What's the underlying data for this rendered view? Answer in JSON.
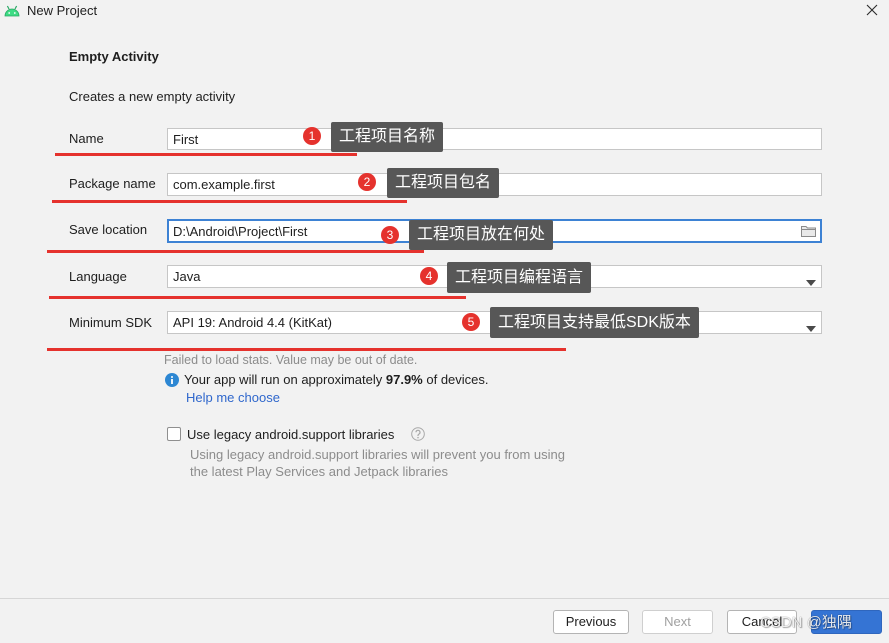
{
  "window": {
    "title": "New Project",
    "icon": "android-icon",
    "close_icon": "close-icon"
  },
  "header": {
    "title": "Empty Activity",
    "subtitle": "Creates a new empty activity"
  },
  "form": {
    "name": {
      "label": "Name",
      "value": "First"
    },
    "package": {
      "label": "Package name",
      "value": "com.example.first"
    },
    "save_location": {
      "label": "Save location",
      "value": "D:\\Android\\Project\\First",
      "icon": "folder-icon",
      "focused": true
    },
    "language": {
      "label": "Language",
      "value": "Java",
      "icon": "chevron-down-icon"
    },
    "min_sdk": {
      "label": "Minimum SDK",
      "value": "API 19: Android 4.4 (KitKat)",
      "icon": "chevron-down-icon"
    }
  },
  "annotations": [
    {
      "number": "1",
      "text": "工程项目名称"
    },
    {
      "number": "2",
      "text": "工程项目包名"
    },
    {
      "number": "3",
      "text": "工程项目放在何处"
    },
    {
      "number": "4",
      "text": "工程项目编程语言"
    },
    {
      "number": "5",
      "text": "工程项目支持最低SDK版本"
    }
  ],
  "stats": {
    "warning": "Failed to load stats. Value may be out of date.",
    "info_icon": "info-icon",
    "info_prefix": "Your app will run on approximately",
    "percentage": "97.9%",
    "info_suffix": "of devices.",
    "help_link": "Help me choose"
  },
  "legacy": {
    "checked": false,
    "label": "Use legacy android.support libraries",
    "help_icon": "help-icon",
    "description_line1": "Using legacy android.support libraries will prevent you from using",
    "description_line2": "the latest Play Services and Jetpack libraries"
  },
  "buttons": {
    "previous": "Previous",
    "next": "Next",
    "next_disabled": true,
    "cancel": "Cancel"
  },
  "watermark": "CSDN @独隅",
  "colors": {
    "background": "#f2f2f2",
    "accent": "#3574d4",
    "focus_border": "#3d82d4",
    "annotation_red": "#e5322d",
    "callout_bg": "#575757",
    "link": "#2f67cc"
  }
}
